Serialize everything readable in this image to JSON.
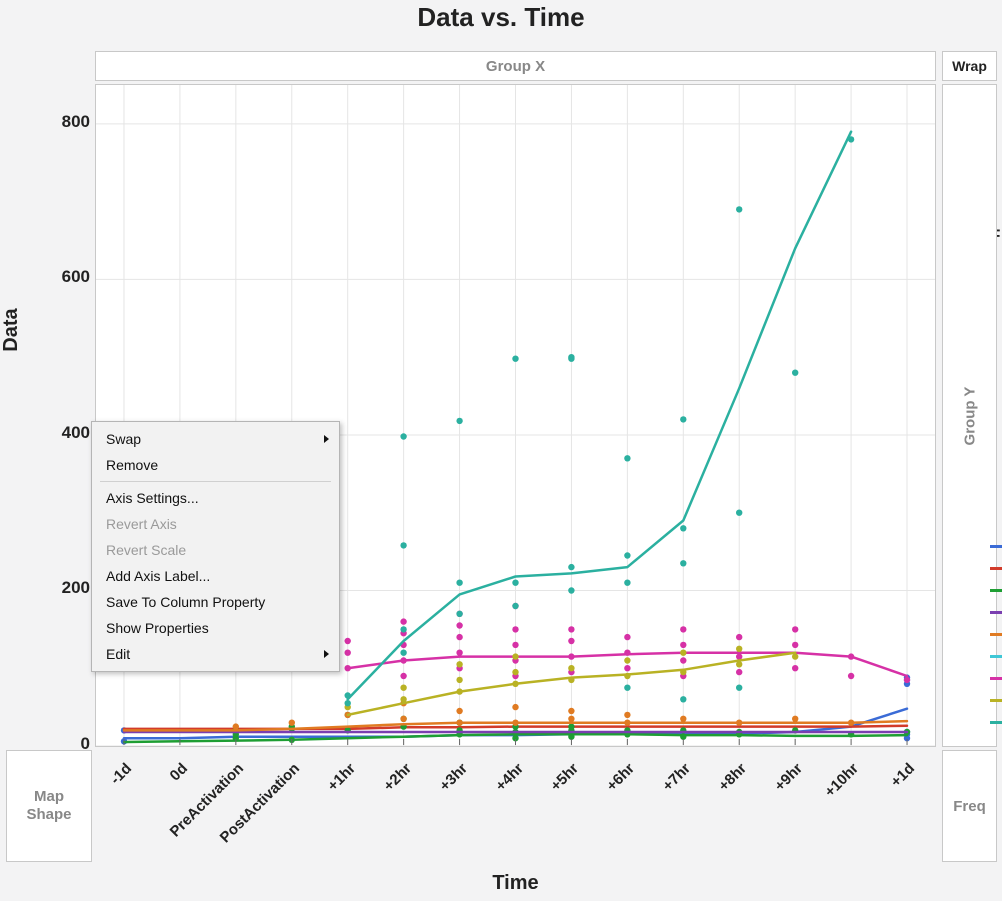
{
  "title": "Data vs. Time",
  "group_top_label": "Group X",
  "group_right_label": "Group Y",
  "wrap_label": "Wrap",
  "freq_label": "Freq",
  "mapshape_label": "Map\nShape",
  "sidechar": "F",
  "axes": {
    "ylabel": "Data",
    "xlabel": "Time",
    "yticks": [
      0,
      200,
      400,
      600,
      800
    ],
    "xticks": [
      "-1d",
      "0d",
      "PreActivation",
      "PostActivation",
      "+1hr",
      "+2hr",
      "+3hr",
      "+4hr",
      "+5hr",
      "+6hr",
      "+7hr",
      "+8hr",
      "+9hr",
      "+10hr",
      "+1d"
    ]
  },
  "context_menu": {
    "items": [
      {
        "label": "Swap",
        "submenu": true,
        "enabled": true
      },
      {
        "label": "Remove",
        "enabled": true
      },
      {
        "sep": true
      },
      {
        "label": "Axis Settings...",
        "enabled": true
      },
      {
        "label": "Revert Axis",
        "enabled": false
      },
      {
        "label": "Revert Scale",
        "enabled": false
      },
      {
        "label": "Add Axis Label...",
        "enabled": true
      },
      {
        "label": "Save To Column Property",
        "enabled": true
      },
      {
        "label": "Show Properties",
        "enabled": true
      },
      {
        "label": "Edit",
        "submenu": true,
        "enabled": true
      }
    ]
  },
  "chart_data": {
    "type": "scatter",
    "title": "Data vs. Time",
    "xlabel": "Time",
    "ylabel": "Data",
    "ylim": [
      0,
      850
    ],
    "categories": [
      "-1d",
      "0d",
      "PreActivation",
      "PostActivation",
      "+1hr",
      "+2hr",
      "+3hr",
      "+4hr",
      "+5hr",
      "+6hr",
      "+7hr",
      "+8hr",
      "+9hr",
      "+10hr",
      "+1d"
    ],
    "legend_colors": [
      "#3a6bd6",
      "#d23b2a",
      "#1e9e33",
      "#7a3fb0",
      "#e07b22",
      "#3fc7d6",
      "#d631a6",
      "#b9b224",
      "#2bb0a0"
    ],
    "series": [
      {
        "name": "blue",
        "color": "#3a6bd6",
        "line": [
          10,
          10,
          12,
          12,
          12,
          12,
          14,
          14,
          15,
          15,
          15,
          16,
          18,
          25,
          48
        ],
        "points": [
          [
            0,
            20
          ],
          [
            0,
            6
          ],
          [
            14,
            85
          ],
          [
            14,
            88
          ],
          [
            14,
            80
          ],
          [
            14,
            18
          ],
          [
            14,
            15
          ],
          [
            14,
            10
          ]
        ]
      },
      {
        "name": "red",
        "color": "#d23b2a",
        "line": [
          22,
          22,
          22,
          22,
          22,
          24,
          24,
          25,
          25,
          25,
          25,
          25,
          25,
          25,
          26
        ],
        "points": []
      },
      {
        "name": "green",
        "color": "#1e9e33",
        "line": [
          5,
          6,
          7,
          8,
          10,
          12,
          14,
          15,
          15,
          15,
          14,
          14,
          13,
          13,
          14
        ],
        "points": [
          [
            2,
            10
          ],
          [
            2,
            20
          ],
          [
            2,
            15
          ],
          [
            3,
            8
          ],
          [
            3,
            22
          ],
          [
            3,
            25
          ],
          [
            4,
            20
          ],
          [
            4,
            40
          ],
          [
            5,
            25
          ],
          [
            5,
            35
          ],
          [
            6,
            20
          ],
          [
            6,
            15
          ],
          [
            6,
            30
          ],
          [
            7,
            18
          ],
          [
            7,
            25
          ],
          [
            7,
            10
          ],
          [
            8,
            20
          ],
          [
            8,
            12
          ],
          [
            8,
            25
          ],
          [
            9,
            20
          ],
          [
            9,
            15
          ],
          [
            10,
            12
          ],
          [
            10,
            20
          ],
          [
            11,
            18
          ],
          [
            11,
            15
          ],
          [
            12,
            20
          ],
          [
            13,
            15
          ],
          [
            14,
            18
          ]
        ]
      },
      {
        "name": "purple",
        "color": "#7a3fb0",
        "line": [
          18,
          18,
          18,
          18,
          18,
          18,
          18,
          18,
          18,
          18,
          18,
          18,
          18,
          18,
          18
        ],
        "points": []
      },
      {
        "name": "orange",
        "color": "#e07b22",
        "line": [
          20,
          20,
          20,
          22,
          25,
          28,
          30,
          30,
          30,
          30,
          30,
          30,
          30,
          30,
          32
        ],
        "points": [
          [
            2,
            25
          ],
          [
            3,
            30
          ],
          [
            4,
            40
          ],
          [
            5,
            55
          ],
          [
            5,
            35
          ],
          [
            6,
            30
          ],
          [
            6,
            45
          ],
          [
            7,
            30
          ],
          [
            7,
            50
          ],
          [
            8,
            35
          ],
          [
            8,
            45
          ],
          [
            9,
            30
          ],
          [
            9,
            40
          ],
          [
            10,
            35
          ],
          [
            11,
            30
          ],
          [
            12,
            35
          ],
          [
            13,
            30
          ]
        ]
      },
      {
        "name": "magenta",
        "color": "#d631a6",
        "line": [
          null,
          null,
          null,
          null,
          100,
          110,
          115,
          115,
          115,
          118,
          120,
          120,
          120,
          115,
          90
        ],
        "points": [
          [
            4,
            100
          ],
          [
            4,
            120
          ],
          [
            4,
            135
          ],
          [
            5,
            90
          ],
          [
            5,
            110
          ],
          [
            5,
            130
          ],
          [
            5,
            145
          ],
          [
            5,
            160
          ],
          [
            6,
            100
          ],
          [
            6,
            120
          ],
          [
            6,
            140
          ],
          [
            6,
            155
          ],
          [
            6,
            170
          ],
          [
            7,
            90
          ],
          [
            7,
            110
          ],
          [
            7,
            130
          ],
          [
            7,
            150
          ],
          [
            7,
            180
          ],
          [
            8,
            95
          ],
          [
            8,
            115
          ],
          [
            8,
            135
          ],
          [
            8,
            150
          ],
          [
            9,
            100
          ],
          [
            9,
            120
          ],
          [
            9,
            140
          ],
          [
            10,
            90
          ],
          [
            10,
            110
          ],
          [
            10,
            130
          ],
          [
            10,
            150
          ],
          [
            11,
            95
          ],
          [
            11,
            115
          ],
          [
            11,
            140
          ],
          [
            12,
            100
          ],
          [
            12,
            130
          ],
          [
            12,
            150
          ],
          [
            13,
            90
          ],
          [
            13,
            115
          ],
          [
            14,
            85
          ]
        ]
      },
      {
        "name": "yellow",
        "color": "#b9b224",
        "line": [
          null,
          null,
          null,
          null,
          40,
          55,
          70,
          80,
          88,
          92,
          98,
          110,
          120,
          null,
          null
        ],
        "points": [
          [
            4,
            50
          ],
          [
            5,
            60
          ],
          [
            5,
            75
          ],
          [
            6,
            70
          ],
          [
            6,
            85
          ],
          [
            6,
            105
          ],
          [
            7,
            80
          ],
          [
            7,
            95
          ],
          [
            7,
            115
          ],
          [
            8,
            85
          ],
          [
            8,
            100
          ],
          [
            9,
            90
          ],
          [
            9,
            110
          ],
          [
            10,
            95
          ],
          [
            10,
            120
          ],
          [
            11,
            105
          ],
          [
            11,
            125
          ],
          [
            12,
            115
          ]
        ]
      },
      {
        "name": "teal",
        "color": "#2bb0a0",
        "line": [
          null,
          null,
          null,
          null,
          60,
          135,
          195,
          218,
          222,
          230,
          290,
          460,
          640,
          790,
          null
        ],
        "points": [
          [
            4,
            65
          ],
          [
            4,
            55
          ],
          [
            5,
            120
          ],
          [
            5,
            150
          ],
          [
            5,
            258
          ],
          [
            5,
            398
          ],
          [
            6,
            170
          ],
          [
            6,
            210
          ],
          [
            6,
            418
          ],
          [
            7,
            180
          ],
          [
            7,
            210
          ],
          [
            7,
            498
          ],
          [
            8,
            200
          ],
          [
            8,
            230
          ],
          [
            8,
            498
          ],
          [
            8,
            500
          ],
          [
            9,
            210
          ],
          [
            9,
            245
          ],
          [
            9,
            370
          ],
          [
            10,
            235
          ],
          [
            10,
            280
          ],
          [
            10,
            420
          ],
          [
            11,
            300
          ],
          [
            11,
            690
          ],
          [
            12,
            480
          ],
          [
            13,
            780
          ],
          [
            9,
            75
          ],
          [
            10,
            60
          ],
          [
            11,
            75
          ]
        ]
      }
    ]
  }
}
